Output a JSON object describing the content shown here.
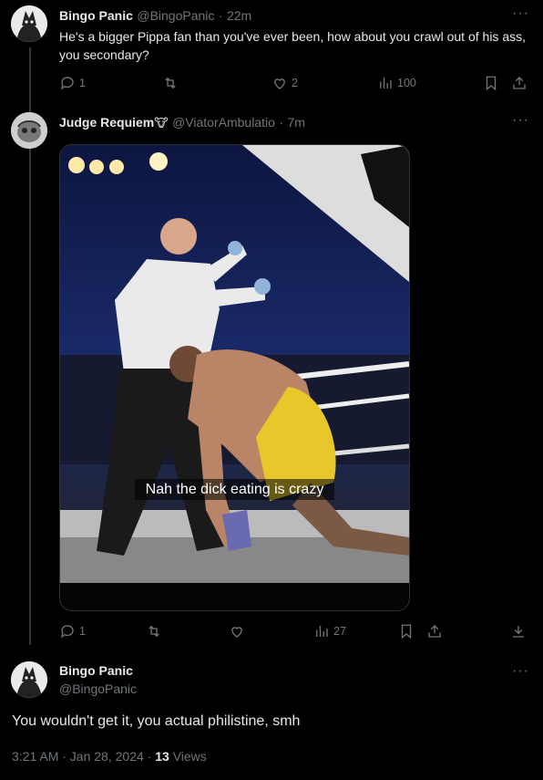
{
  "tweet1": {
    "name": "Bingo Panic",
    "handle": "@BingoPanic",
    "sep": "·",
    "time": "22m",
    "text": "He's a bigger Pippa fan than you've ever been, how about you crawl out of his ass, you secondary?",
    "replies": "1",
    "likes": "2",
    "views": "100"
  },
  "tweet2": {
    "name": "Judge Requiem",
    "emoji": "🐮",
    "handle": "@ViatorAmbulatio",
    "sep": "·",
    "time": "7m",
    "caption": "Nah the dick eating is crazy",
    "replies": "1",
    "views": "27"
  },
  "tweet3": {
    "name": "Bingo Panic",
    "handle": "@BingoPanic",
    "text": "You wouldn't get it, you actual philistine, smh",
    "timestamp": "3:21 AM · Jan 28, 2024 ·",
    "views_count": "13",
    "views_label": "Views"
  },
  "icons": [
    "reply-icon",
    "retweet-icon",
    "like-icon",
    "views-icon",
    "bookmark-icon",
    "share-icon",
    "download-icon",
    "more-icon"
  ],
  "colors": {
    "background": "#000000",
    "text": "#e7e9ea",
    "muted": "#71767b",
    "border": "#2f3336"
  }
}
